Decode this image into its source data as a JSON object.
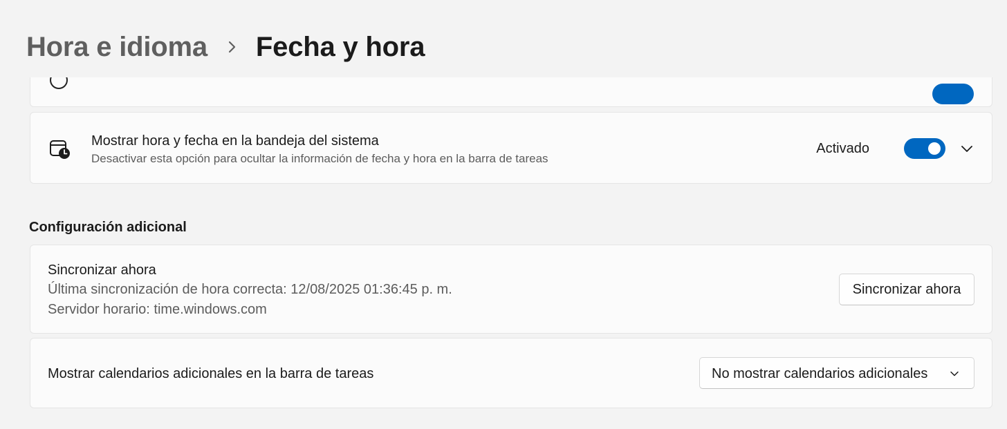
{
  "breadcrumb": {
    "parent": "Hora e idioma",
    "current": "Fecha y hora"
  },
  "tray_setting": {
    "icon": "calendar-clock-icon",
    "title": "Mostrar hora y fecha en la bandeja del sistema",
    "description": "Desactivar esta opción para ocultar la información de fecha y hora en la barra de tareas",
    "state_label": "Activado",
    "enabled": true
  },
  "additional": {
    "heading": "Configuración adicional",
    "sync": {
      "title": "Sincronizar ahora",
      "last_sync": "Última sincronización de hora correcta: 12/08/2025 01:36:45 p. m.",
      "server": "Servidor horario: time.windows.com",
      "button_label": "Sincronizar ahora"
    },
    "calendars": {
      "label": "Mostrar calendarios adicionales en la barra de tareas",
      "selected": "No mostrar calendarios adicionales"
    }
  },
  "colors": {
    "accent": "#0067c0",
    "background": "#f3f3f3",
    "card": "#fbfbfb",
    "secondary_text": "#5c5c5c"
  }
}
